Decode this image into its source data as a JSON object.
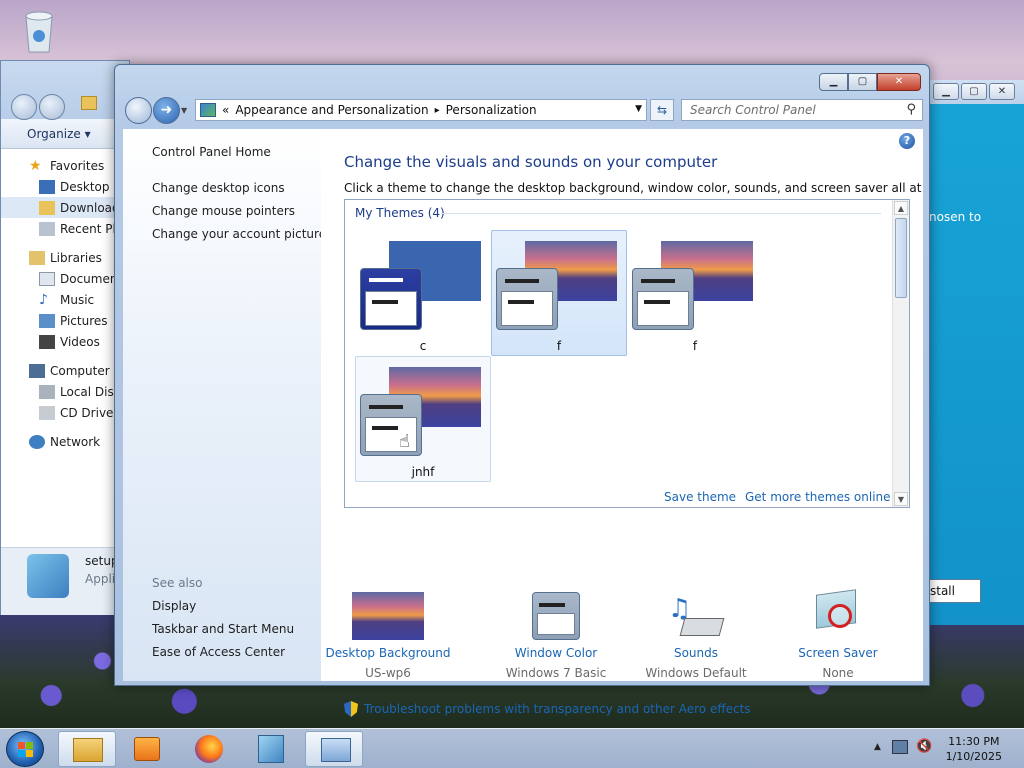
{
  "explorer": {
    "toolbar_organize": "Organize ▾",
    "tree": {
      "favorites": "Favorites",
      "desktop": "Desktop",
      "downloads": "Download",
      "recent": "Recent Pla",
      "libraries": "Libraries",
      "documents": "Document",
      "music": "Music",
      "pictures": "Pictures",
      "videos": "Videos",
      "computer": "Computer",
      "local_disk": "Local Disk",
      "cd_drive": "CD Drive (",
      "network": "Network"
    },
    "detail": {
      "name": "setup",
      "sub": "Appli"
    }
  },
  "right_window": {
    "text": "nosen to",
    "install_label": "stall"
  },
  "control_panel": {
    "caption": {
      "minimize": "▁",
      "maximize": "▢",
      "close": "✕"
    },
    "breadcrumb": {
      "sep": "«",
      "parent": "Appearance and Personalization",
      "arrow": "▸",
      "current": "Personalization"
    },
    "search_placeholder": "Search Control Panel",
    "left_links": {
      "home": "Control Panel Home",
      "desktop_icons": "Change desktop icons",
      "mouse_pointers": "Change mouse pointers",
      "account_picture": "Change your account picture",
      "see_also": "See also",
      "display": "Display",
      "taskbar": "Taskbar and Start Menu",
      "ease": "Ease of Access Center"
    },
    "heading": "Change the visuals and sounds on your computer",
    "subheading": "Click a theme to change the desktop background, window color, sounds, and screen saver all at once.",
    "themes_group": "My Themes (4)",
    "themes": [
      {
        "name": "c"
      },
      {
        "name": "f"
      },
      {
        "name": "f"
      },
      {
        "name": "jnhf"
      }
    ],
    "save_theme": "Save theme",
    "get_more": "Get more themes online",
    "bottom": [
      {
        "link": "Desktop Background",
        "value": "US-wp6"
      },
      {
        "link": "Window Color",
        "value": "Windows 7 Basic"
      },
      {
        "link": "Sounds",
        "value": "Windows Default"
      },
      {
        "link": "Screen Saver",
        "value": "None"
      }
    ],
    "troubleshoot": "Troubleshoot problems with transparency and other Aero effects",
    "help": "?"
  },
  "taskbar": {
    "time": "11:30 PM",
    "date": "1/10/2025"
  }
}
